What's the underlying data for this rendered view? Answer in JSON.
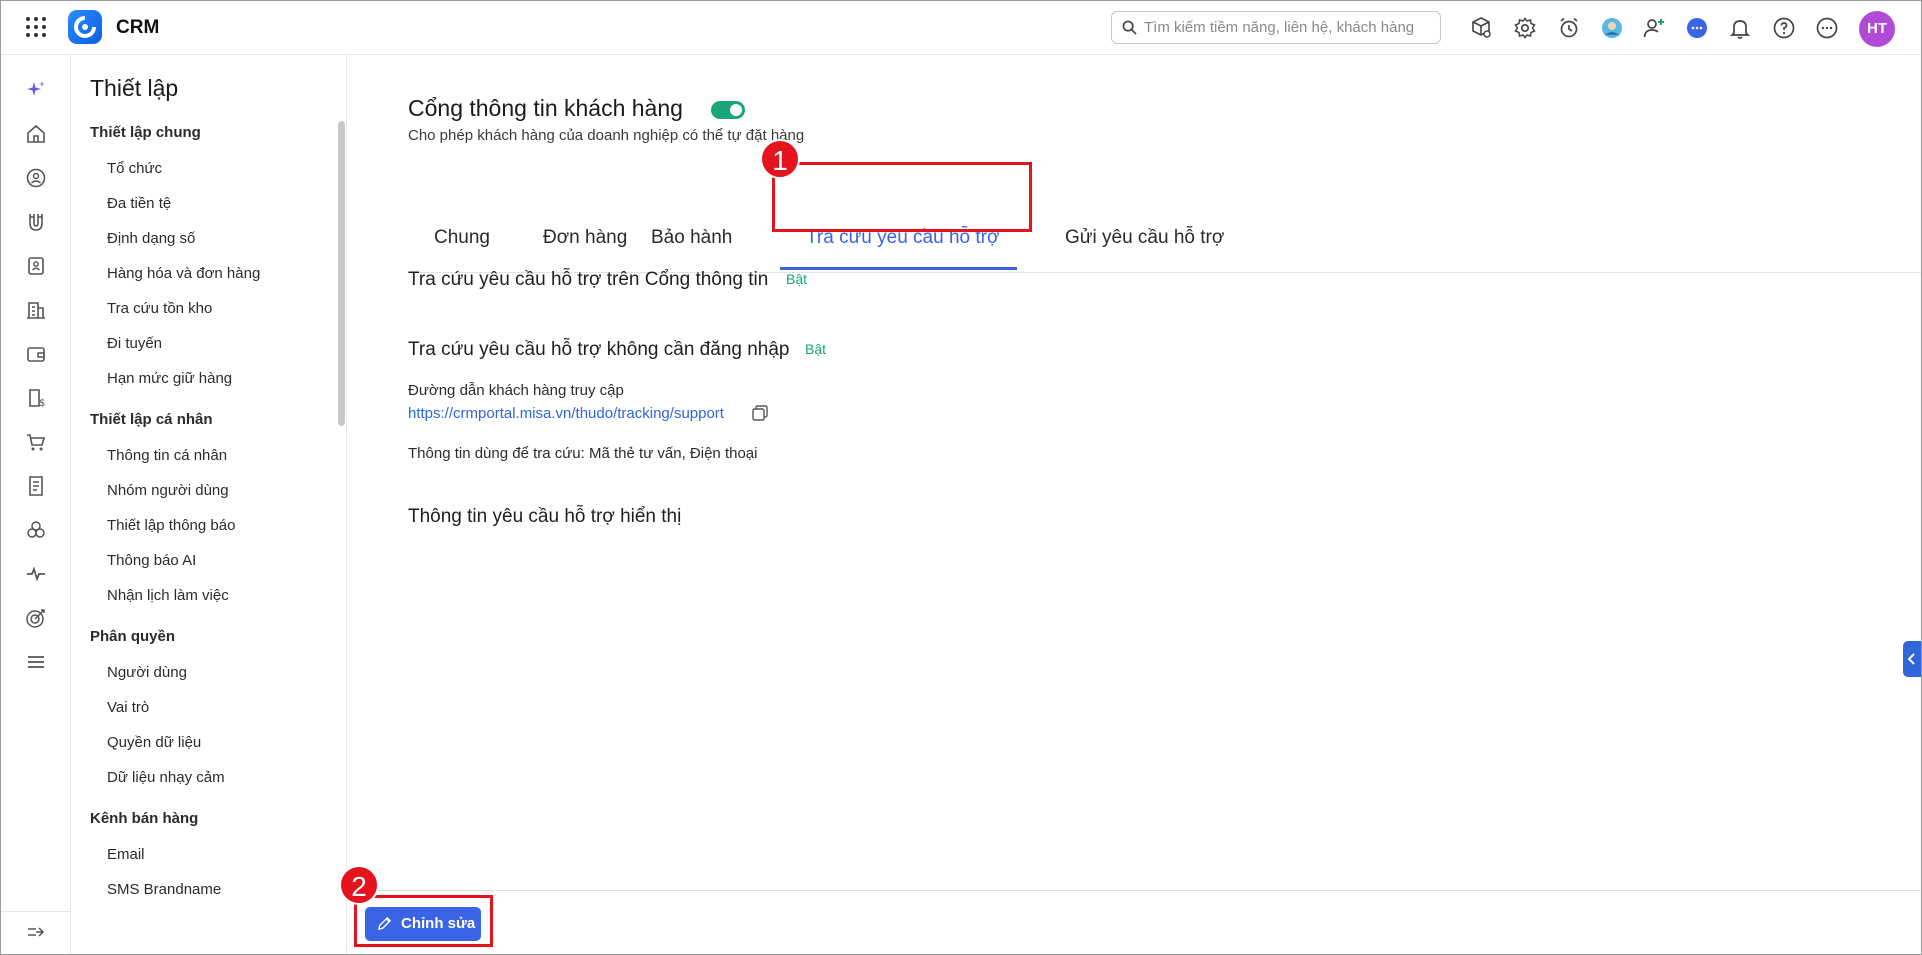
{
  "header": {
    "app_name": "CRM",
    "search_placeholder": "Tìm kiếm tiềm năng, liên hệ, khách hàng",
    "avatar_initials": "HT"
  },
  "sidebar": {
    "title": "Thiết lập",
    "groups": [
      {
        "label": "Thiết lập chung",
        "items": [
          "Tổ chức",
          "Đa tiền tệ",
          "Định dạng số",
          "Hàng hóa và đơn hàng",
          "Tra cứu tồn kho",
          "Đi tuyến",
          "Hạn mức giữ hàng"
        ]
      },
      {
        "label": "Thiết lập cá nhân",
        "items": [
          "Thông tin cá nhân",
          "Nhóm người dùng",
          "Thiết lập thông báo",
          "Thông báo AI",
          "Nhận lịch làm việc"
        ]
      },
      {
        "label": "Phân quyền",
        "items": [
          "Người dùng",
          "Vai trò",
          "Quyền dữ liệu",
          "Dữ liệu nhạy cảm"
        ]
      },
      {
        "label": "Kênh bán hàng",
        "items": [
          "Email",
          "SMS Brandname"
        ]
      }
    ]
  },
  "main": {
    "title": "Cổng thông tin khách hàng",
    "toggle_on": true,
    "subtitle": "Cho phép khách hàng của doanh nghiệp có thể tự đặt hàng",
    "tabs": [
      "Chung",
      "Đơn hàng",
      "Bảo hành",
      "Tra cứu yêu cầu hỗ trợ",
      "Gửi yêu cầu hỗ trợ"
    ],
    "active_tab": "Tra cứu yêu cầu hỗ trợ",
    "section1_title": "Tra cứu yêu cầu hỗ trợ trên Cổng thông tin",
    "section1_status": "Bật",
    "section2_title": "Tra cứu yêu cầu hỗ trợ không cần đăng nhập",
    "section2_status": "Bật",
    "access_label": "Đường dẫn khách hàng truy cập",
    "access_url": "https://crmportal.misa.vn/thudo/tracking/support",
    "lookup_info_label": "Thông tin dùng để tra cứu:",
    "lookup_info_value": "Mã thẻ tư vấn, Điện thoại",
    "section3_title": "Thông tin yêu cầu hỗ trợ hiển thị"
  },
  "footer": {
    "edit_label": "Chỉnh sửa"
  },
  "annotations": {
    "marker1": "1",
    "marker2": "2",
    "color": "#e5131d"
  },
  "colors": {
    "accent": "#3b63e6",
    "success": "#1aa67a",
    "link": "#2f66d8"
  }
}
